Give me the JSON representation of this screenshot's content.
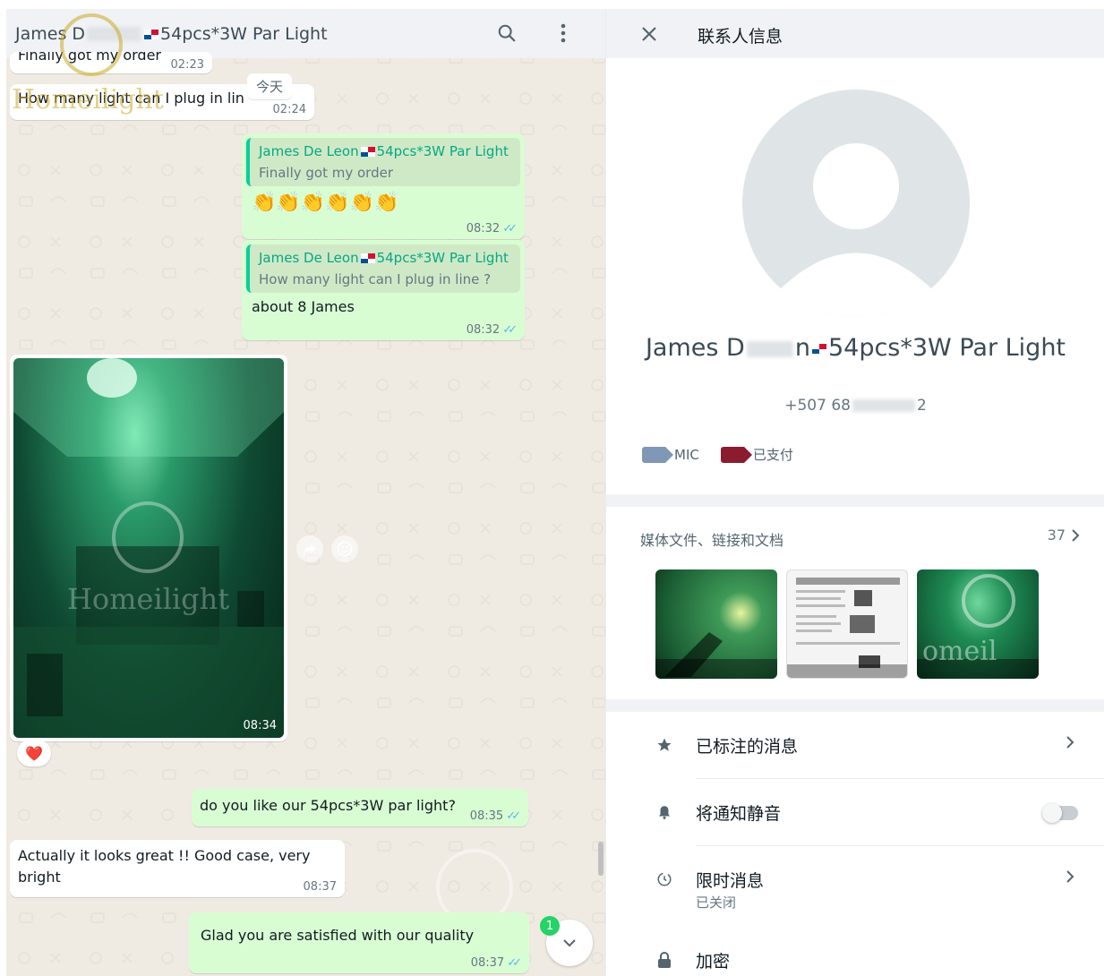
{
  "chat": {
    "header": {
      "title_prefix": "James D",
      "title_suffix": "54pcs*3W Par Light"
    },
    "date_chip": "今天",
    "watermark": "Homeilight",
    "messages": [
      {
        "type": "in",
        "text": "Finally got my order",
        "time": "02:23"
      },
      {
        "type": "in",
        "text": "How many light can I plug in lin",
        "time": "02:24"
      },
      {
        "type": "out",
        "quote_name": "James De Leon",
        "quote_tag": "54pcs*3W Par Light",
        "quote_text": "Finally got my order",
        "text": "👏👏👏👏👏👏",
        "time": "08:32"
      },
      {
        "type": "out",
        "quote_name": "James De Leon",
        "quote_tag": "54pcs*3W Par Light",
        "quote_text": "How many light can I plug in line ?",
        "text": "about 8 James",
        "time": "08:32"
      },
      {
        "type": "photo",
        "time": "08:34",
        "reaction": "❤️"
      },
      {
        "type": "out",
        "text": "do you like our 54pcs*3W par light?",
        "time": "08:35"
      },
      {
        "type": "in",
        "text": "Actually it looks great !! Good case, very bright",
        "time": "08:37"
      },
      {
        "type": "out",
        "text": "Glad you are satisfied with our quality",
        "time": "08:37"
      }
    ],
    "unread_count": "1",
    "colors": {
      "outgoing": "#d9fdd3",
      "incoming": "#ffffff",
      "ticks": "#53bdeb",
      "accent": "#06cf9c"
    }
  },
  "info": {
    "title": "联系人信息",
    "name_prefix": "James D",
    "name_mid": "n",
    "name_suffix": "54pcs*3W Par Light",
    "phone_prefix": "+507 68",
    "phone_suffix": "2",
    "labels": [
      {
        "name": "MIC",
        "color": "#7f98b5"
      },
      {
        "name": "已支付",
        "color": "#8b1b2e"
      }
    ],
    "media": {
      "title": "媒体文件、链接和文档",
      "count": "37"
    },
    "rows": [
      {
        "label": "已标注的消息",
        "icon": "star-icon"
      },
      {
        "label": "将通知静音",
        "icon": "bell-icon",
        "toggle_on": false
      },
      {
        "label": "限时消息",
        "sub": "已关闭",
        "icon": "timer-icon"
      },
      {
        "label": "加密",
        "icon": "lock-icon"
      }
    ]
  }
}
